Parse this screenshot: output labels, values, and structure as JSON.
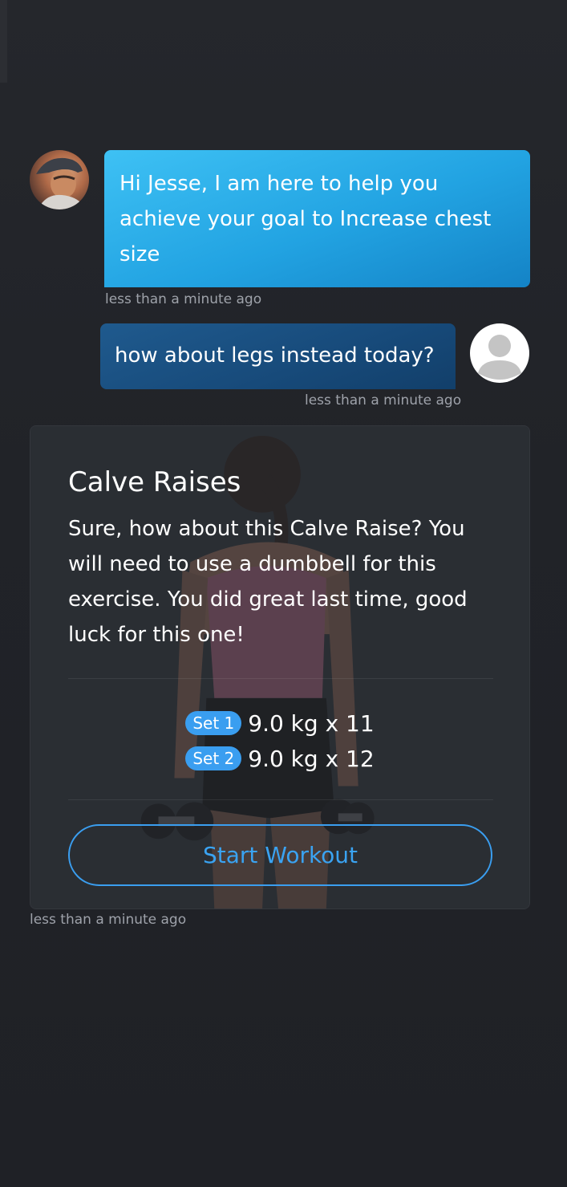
{
  "chat": {
    "coach_message": "Hi Jesse, I am here to help you achieve your goal to Increase chest size",
    "coach_message_time": "less than a minute ago",
    "user_message": "how about legs instead today?",
    "user_message_time": "less than a minute ago"
  },
  "workout_card": {
    "title": "Calve Raises",
    "description": "Sure, how about this Calve Raise? You will need to use a dumbbell for this exercise. You did great last time, good luck for this one!",
    "sets": [
      {
        "label": "Set 1",
        "value": "9.0 kg x 11"
      },
      {
        "label": "Set 2",
        "value": "9.0 kg x 12"
      }
    ],
    "start_button": "Start Workout",
    "time": "less than a minute ago"
  },
  "colors": {
    "background": "#212328",
    "coach_bubble": "#22a3e2",
    "user_bubble": "#174a7a",
    "accent": "#3a9ef0",
    "timestamp": "#9ea2aa"
  },
  "icons": {
    "user_avatar": "default-person-icon",
    "coach_avatar": "coach-photo"
  }
}
